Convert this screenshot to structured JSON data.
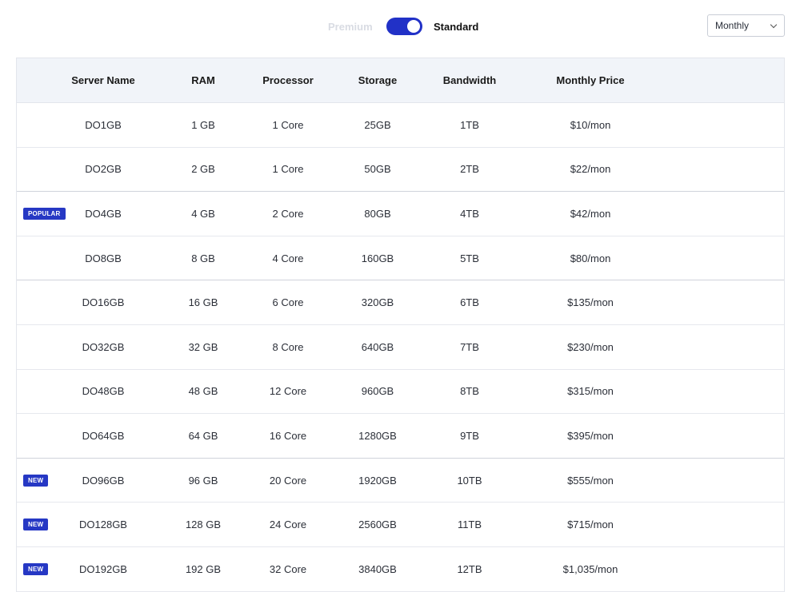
{
  "toggle": {
    "off_label": "Premium",
    "on_label": "Standard",
    "active": "Standard",
    "accent": "#2131c7"
  },
  "period_select": {
    "value": "Monthly"
  },
  "table": {
    "headers": [
      "Server Name",
      "RAM",
      "Processor",
      "Storage",
      "Bandwidth",
      "Monthly Price"
    ],
    "rows": [
      {
        "badge": "",
        "name": "DO1GB",
        "ram": "1 GB",
        "processor": "1 Core",
        "storage": "25GB",
        "bandwidth": "1TB",
        "price": "$10/mon"
      },
      {
        "badge": "",
        "name": "DO2GB",
        "ram": "2 GB",
        "processor": "1 Core",
        "storage": "50GB",
        "bandwidth": "2TB",
        "price": "$22/mon"
      },
      {
        "badge": "POPULAR",
        "name": "DO4GB",
        "ram": "4 GB",
        "processor": "2 Core",
        "storage": "80GB",
        "bandwidth": "4TB",
        "price": "$42/mon"
      },
      {
        "badge": "",
        "name": "DO8GB",
        "ram": "8 GB",
        "processor": "4 Core",
        "storage": "160GB",
        "bandwidth": "5TB",
        "price": "$80/mon"
      },
      {
        "badge": "",
        "name": "DO16GB",
        "ram": "16 GB",
        "processor": "6 Core",
        "storage": "320GB",
        "bandwidth": "6TB",
        "price": "$135/mon"
      },
      {
        "badge": "",
        "name": "DO32GB",
        "ram": "32 GB",
        "processor": "8 Core",
        "storage": "640GB",
        "bandwidth": "7TB",
        "price": "$230/mon"
      },
      {
        "badge": "",
        "name": "DO48GB",
        "ram": "48 GB",
        "processor": "12 Core",
        "storage": "960GB",
        "bandwidth": "8TB",
        "price": "$315/mon"
      },
      {
        "badge": "",
        "name": "DO64GB",
        "ram": "64 GB",
        "processor": "16 Core",
        "storage": "1280GB",
        "bandwidth": "9TB",
        "price": "$395/mon"
      },
      {
        "badge": "NEW",
        "name": "DO96GB",
        "ram": "96 GB",
        "processor": "20 Core",
        "storage": "1920GB",
        "bandwidth": "10TB",
        "price": "$555/mon"
      },
      {
        "badge": "NEW",
        "name": "DO128GB",
        "ram": "128 GB",
        "processor": "24 Core",
        "storage": "2560GB",
        "bandwidth": "11TB",
        "price": "$715/mon"
      },
      {
        "badge": "NEW",
        "name": "DO192GB",
        "ram": "192 GB",
        "processor": "32 Core",
        "storage": "3840GB",
        "bandwidth": "12TB",
        "price": "$1,035/mon"
      }
    ]
  }
}
